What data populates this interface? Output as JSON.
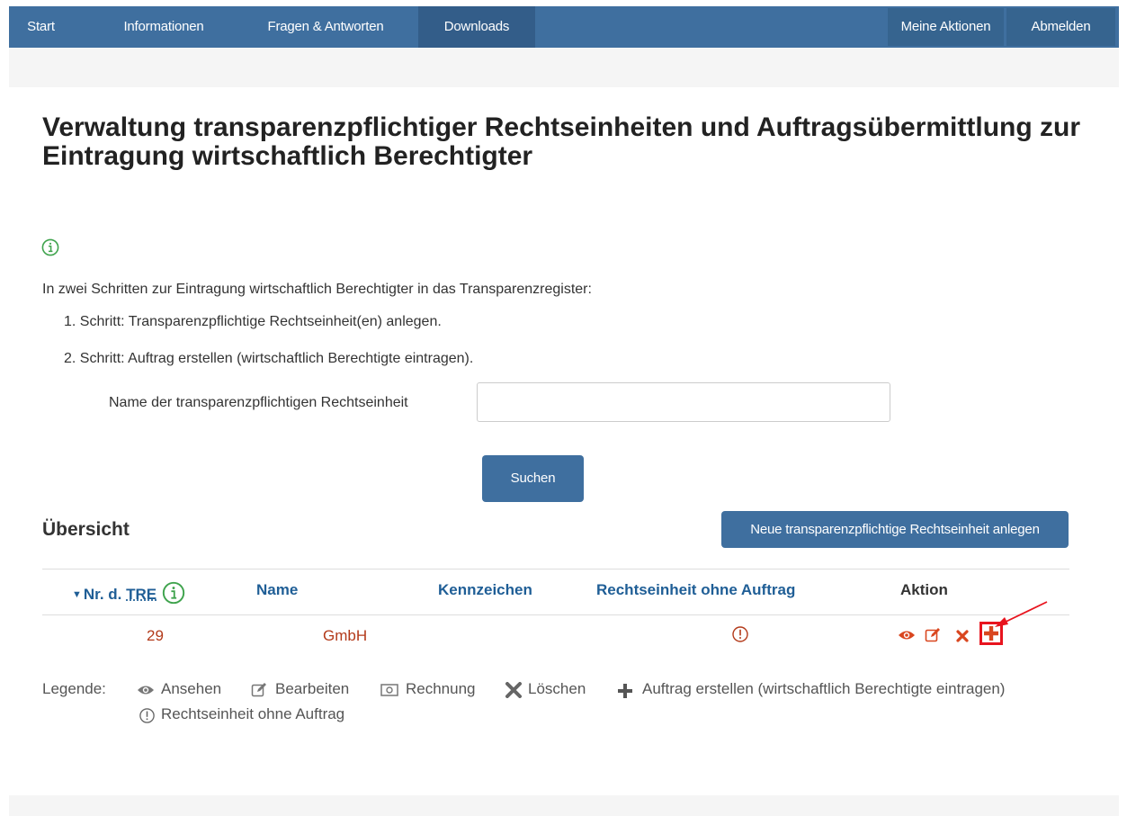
{
  "nav": {
    "start": "Start",
    "informationen": "Informationen",
    "fragen": "Fragen & Antworten",
    "downloads": "Downloads",
    "meine_aktionen": "Meine Aktionen",
    "abmelden": "Abmelden"
  },
  "page": {
    "title": "Verwaltung transparenzpflichtiger Rechtseinheiten und Auftragsübermittlung zur Eintragung wirtschaftlich Berechtigter",
    "intro": "In zwei Schritten zur Eintragung wirtschaftlich Berechtigter in das Transparenzregister:",
    "step1": "1. Schritt: Transparenzpflichtige Rechtseinheit(en) anlegen.",
    "step2": "2. Schritt: Auftrag erstellen (wirtschaftlich Berechtigte eintragen)."
  },
  "search": {
    "label": "Name der transparenzpflichtigen Rechtseinheit",
    "value": "",
    "button": "Suchen"
  },
  "overview": {
    "title": "Übersicht",
    "new_button": "Neue transparenzpflichtige Rechtseinheit anlegen",
    "columns": {
      "nr_prefix": "Nr. d.",
      "nr_abbr": "TRE",
      "name": "Name",
      "kennzeichen": "Kennzeichen",
      "ohne_auftrag": "Rechtseinheit ohne Auftrag",
      "aktion": "Aktion"
    },
    "rows": [
      {
        "nr": "29",
        "name": "GmbH",
        "kennzeichen": ""
      }
    ]
  },
  "legend": {
    "label": "Legende:",
    "ansehen": "Ansehen",
    "bearbeiten": "Bearbeiten",
    "rechnung": "Rechnung",
    "loeschen": "Löschen",
    "auftrag": "Auftrag erstellen (wirtschaftlich Berechtigte eintragen)",
    "ohne_auftrag": "Rechtseinheit ohne Auftrag"
  },
  "colors": {
    "nav_bg": "#3f6f9f",
    "link_blue": "#1f5e96",
    "row_red": "#b33a1a",
    "highlight_red": "#e8141e",
    "info_green": "#3fa34d"
  },
  "icons": {
    "info": "info-circle-icon",
    "eye": "eye-icon",
    "edit": "edit-icon",
    "delete": "x-icon",
    "add": "plus-icon",
    "invoice": "invoice-icon",
    "warning": "exclamation-circle-icon"
  }
}
